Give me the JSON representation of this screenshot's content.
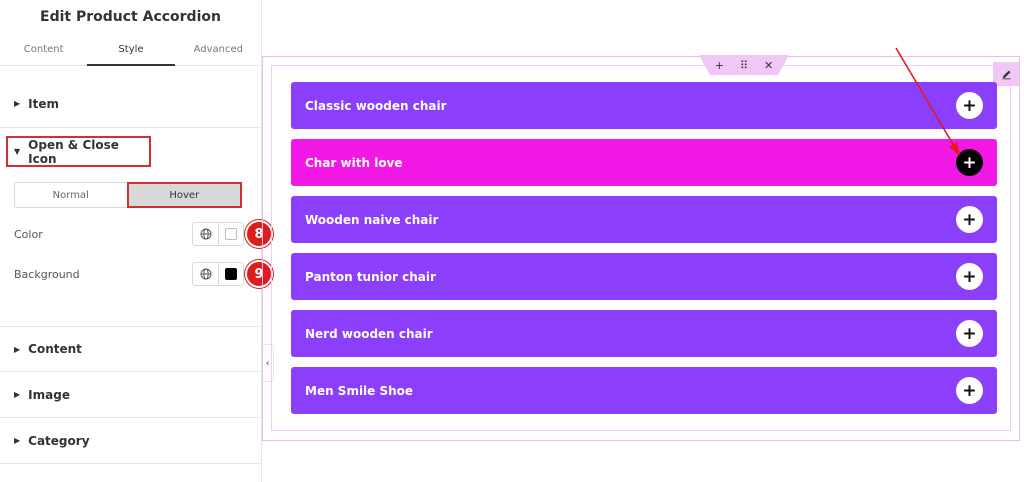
{
  "panel": {
    "title": "Edit Product Accordion",
    "tabs": [
      "Content",
      "Style",
      "Advanced"
    ],
    "sections": {
      "item": "Item",
      "open_close": "Open & Close Icon",
      "content": "Content",
      "image": "Image",
      "category": "Category"
    },
    "state_toggle": {
      "normal": "Normal",
      "hover": "Hover",
      "selected": "Hover"
    },
    "controls": {
      "color": {
        "label": "Color",
        "swatch": "#ffffff",
        "badge": "8"
      },
      "background": {
        "label": "Background",
        "swatch": "#000000",
        "badge": "9"
      }
    }
  },
  "accordion": {
    "items": [
      {
        "title": "Classic wooden chair"
      },
      {
        "title": "Char with love"
      },
      {
        "title": "Wooden naive chair"
      },
      {
        "title": "Panton tunior chair"
      },
      {
        "title": "Nerd wooden chair"
      },
      {
        "title": "Men Smile Shoe"
      }
    ],
    "active_index": 1
  },
  "colors": {
    "accordion_bg": "#8b3ffa",
    "accordion_active_bg": "#f218e6",
    "highlight": "#d32f2f",
    "badge": "#e01b1b"
  }
}
